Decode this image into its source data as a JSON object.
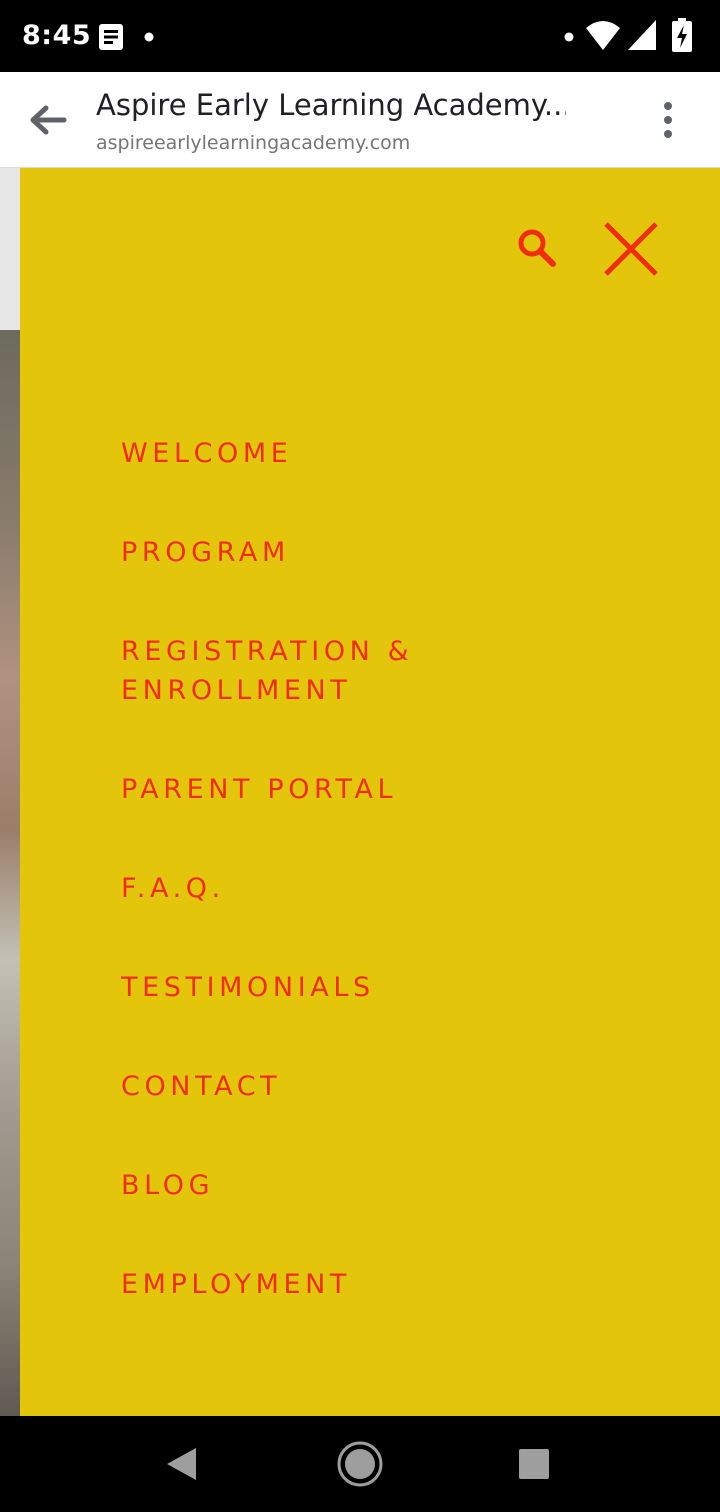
{
  "status_bar": {
    "time": "8:45",
    "icons": [
      "notes-icon",
      "notification-dot-icon",
      "wifi-icon",
      "signal-icon",
      "battery-charging-icon"
    ]
  },
  "browser": {
    "page_title": "Aspire Early Learning Academy...",
    "url": "aspireearlylearningacademy.com",
    "back_icon": "arrow-left-icon",
    "menu_icon": "more-vert-icon"
  },
  "nav_menu": {
    "background_color": "#e3c60b",
    "accent_color": "#f02d0f",
    "search_icon": "search-icon",
    "close_icon": "close-icon",
    "items": [
      {
        "label": "WELCOME"
      },
      {
        "label": "PROGRAM"
      },
      {
        "label_line1": "REGISTRATION &",
        "label_line2": "ENROLLMENT"
      },
      {
        "label": "PARENT PORTAL"
      },
      {
        "label": "F.A.Q."
      },
      {
        "label": "TESTIMONIALS"
      },
      {
        "label": "CONTACT"
      },
      {
        "label": "BLOG"
      },
      {
        "label": "EMPLOYMENT"
      }
    ]
  },
  "android_nav": {
    "buttons": [
      "back-triangle-icon",
      "home-circle-icon",
      "recents-square-icon"
    ]
  }
}
